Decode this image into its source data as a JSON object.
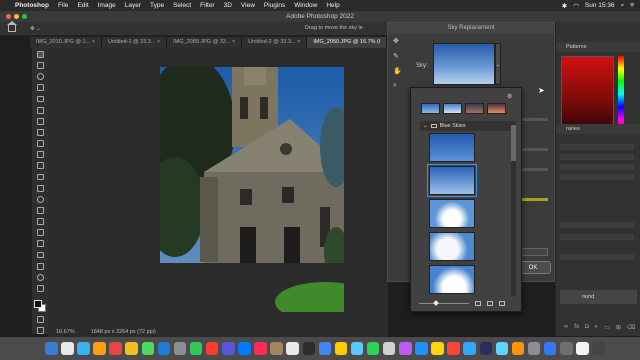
{
  "menubar": {
    "app_name": "Photoshop",
    "items": [
      "File",
      "Edit",
      "Image",
      "Layer",
      "Type",
      "Select",
      "Filter",
      "3D",
      "View",
      "Plugins",
      "Window",
      "Help"
    ],
    "clock": "Sun 15:36"
  },
  "window": {
    "title": "Adobe Photoshop 2022"
  },
  "options": {
    "drag_hint": "Drag to move the sky le"
  },
  "tabs": [
    {
      "label": "IMG_2010.JPG @ 1..."
    },
    {
      "label": "Untitled-1 @ 33.3..."
    },
    {
      "label": "IMG_2089.JPG @ 33..."
    },
    {
      "label": "Untitled-2 @ 33.3..."
    },
    {
      "label": "IMG_2050.JPG @ 16.7% (I"
    }
  ],
  "status": {
    "zoom": "16.67%",
    "doc_info": "1848 px x 3264 px (72 ppi)"
  },
  "right_panel": {
    "top_tab": "Patterns",
    "library_tab": "raries",
    "layer_name": "ound"
  },
  "sky_dialog": {
    "title": "Sky Replacement",
    "sky_label": "Sky:",
    "ok_label": "OK",
    "group_label": "Blue Skies"
  },
  "colors": {
    "selection_outline": "#3d8ee5",
    "foreground": "#111111",
    "background": "#ffffff"
  },
  "dock_count": 35
}
